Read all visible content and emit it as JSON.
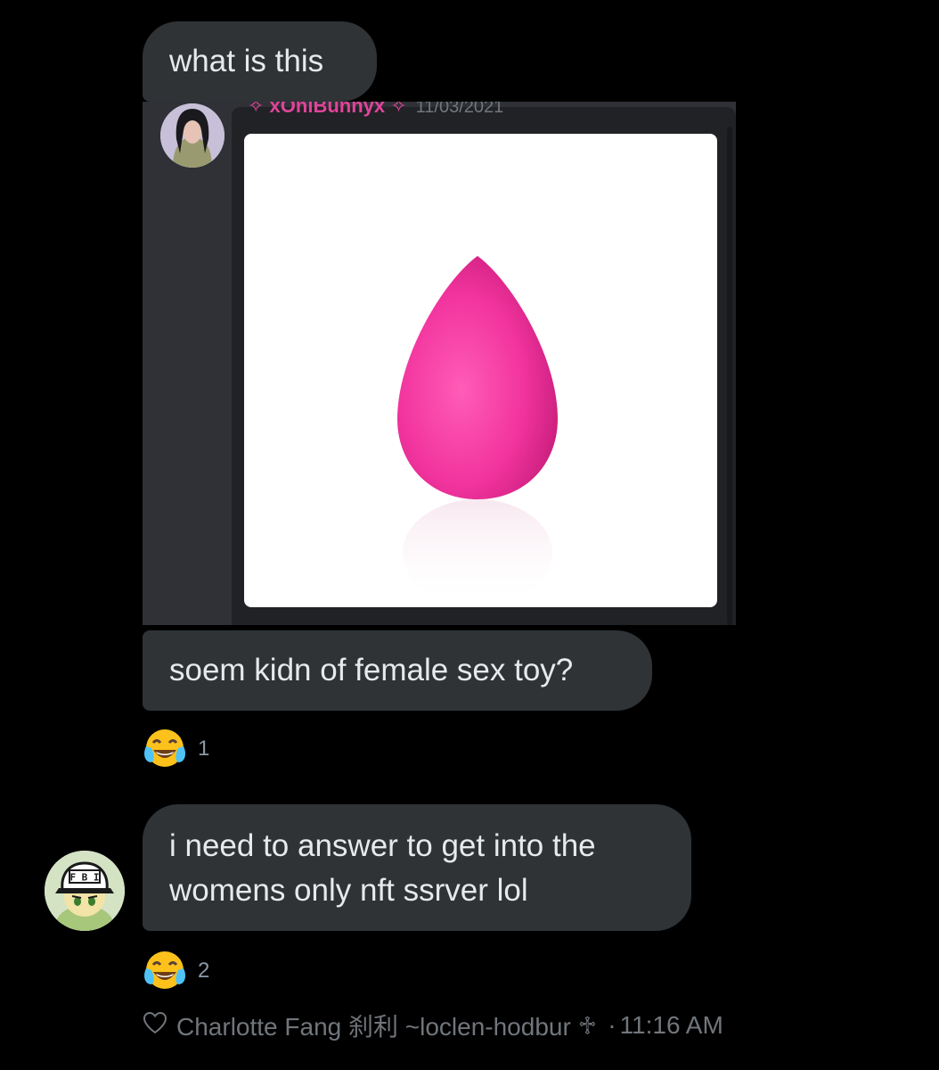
{
  "messages": [
    {
      "text": "what is this"
    },
    {
      "text": "soem kidn of female sex toy?"
    },
    {
      "text": "i need to answer to get into the womens only nft ssrver lol"
    }
  ],
  "embed": {
    "username": "✧ xOniBunnyx ✧",
    "date": "11/03/2021",
    "image_icon": "pink-beauty-sponge",
    "username_color": "#e0449a"
  },
  "reactions": [
    {
      "icon": "face-with-tears-of-joy",
      "count": "1"
    },
    {
      "icon": "face-with-tears-of-joy",
      "count": "2"
    }
  ],
  "footer": {
    "heart_icon": "heart-outline",
    "name": "Charlotte Fang 刹利 ~loclen-hodbur",
    "cross": "♱",
    "separator": "·",
    "time": "11:16 AM"
  },
  "colors": {
    "background": "#000000",
    "bubble": "#2f3336",
    "text": "#e7e9ea",
    "muted": "#71767b"
  }
}
